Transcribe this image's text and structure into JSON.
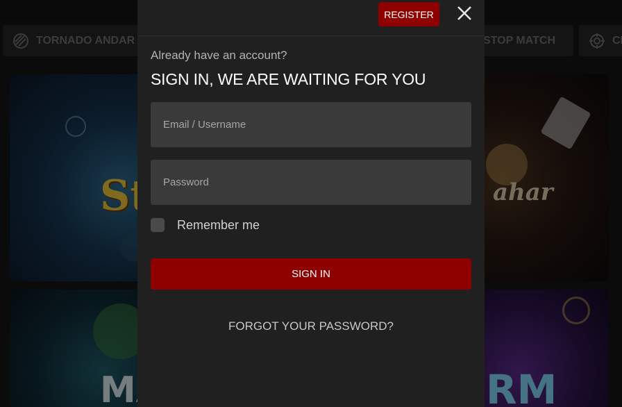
{
  "background": {
    "chips": [
      {
        "label": "TORNADO ANDAR",
        "icon": "circle-stripes-icon"
      },
      {
        "label": "STOP MATCH",
        "icon": ""
      },
      {
        "label": "CI",
        "icon": "crosshair-icon"
      }
    ],
    "cards": [
      {
        "name": "game-card-st",
        "text": "St"
      },
      {
        "name": "game-card-andar-bahar",
        "text": "ahar"
      },
      {
        "name": "game-card-ma",
        "text": "MA"
      },
      {
        "name": "game-card-rm",
        "text": "RM"
      }
    ]
  },
  "modal": {
    "register_label": "REGISTER",
    "close_icon": "close-icon",
    "subtitle": "Already have an account?",
    "title": "SIGN IN, WE ARE WAITING FOR YOU",
    "email": {
      "placeholder": "Email / Username",
      "value": ""
    },
    "password": {
      "placeholder": "Password",
      "value": ""
    },
    "remember_label": "Remember me",
    "remember_checked": false,
    "signin_label": "SIGN IN",
    "forgot_label": "FORGOT YOUR PASSWORD?"
  },
  "colors": {
    "accent": "#8f0000",
    "modal_bg": "#202020",
    "field_bg": "#3a3a3a"
  }
}
